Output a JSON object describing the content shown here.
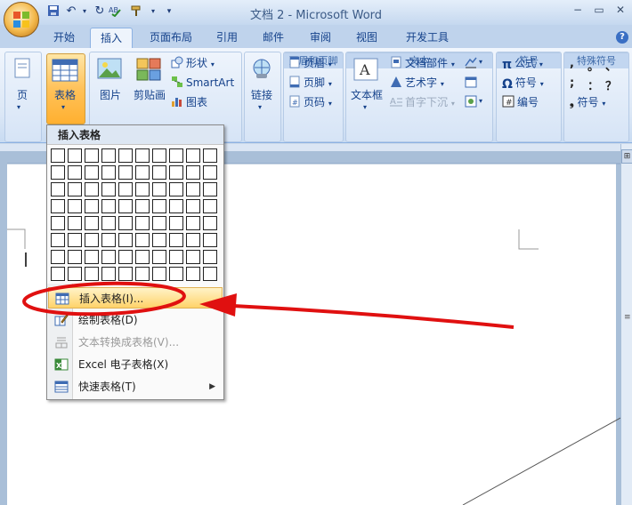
{
  "window": {
    "title": "文档 2 - Microsoft Word"
  },
  "quick_access": {
    "icons": [
      "save-icon",
      "undo-icon",
      "redo-icon",
      "spelling-icon",
      "format-painter-icon",
      "customize-icon"
    ]
  },
  "tabs": [
    "开始",
    "插入",
    "页面布局",
    "引用",
    "邮件",
    "审阅",
    "视图",
    "开发工具"
  ],
  "active_tab": "插入",
  "ribbon": {
    "pages": {
      "label": "页"
    },
    "table": {
      "label": "表格"
    },
    "illustrations": {
      "picture": "图片",
      "clipart": "剪贴画",
      "shapes": "形状",
      "smartart": "SmartArt",
      "chart": "图表"
    },
    "links": {
      "label": "链接"
    },
    "header_footer": {
      "header": "页眉",
      "footer": "页脚",
      "page_number": "页码",
      "group_label": "页眉和页脚"
    },
    "text": {
      "textbox": "文本框",
      "quickparts": "文档部件",
      "wordart": "艺术字",
      "dropcap": "首字下沉",
      "group_label": "文本"
    },
    "symbols": {
      "equation": "公式",
      "symbol": "符号",
      "numbering": "编号",
      "group_label": "符号"
    },
    "special": {
      "row1": [
        ",",
        "。",
        "、"
      ],
      "row2": [
        ";",
        "：",
        "？"
      ],
      "symbol_label": "符号",
      "group_label": "特殊符号"
    }
  },
  "dropdown": {
    "title": "插入表格",
    "grid": {
      "cols": 10,
      "rows": 8
    },
    "items": [
      {
        "label": "插入表格(I)...",
        "icon": "insert-table-icon",
        "enabled": true,
        "highlighted": true
      },
      {
        "label": "绘制表格(D)",
        "icon": "draw-table-icon",
        "enabled": true
      },
      {
        "label": "文本转换成表格(V)...",
        "icon": "convert-text-icon",
        "enabled": false
      },
      {
        "label": "Excel 电子表格(X)",
        "icon": "excel-icon",
        "enabled": true
      },
      {
        "label": "快速表格(T)",
        "icon": "quick-table-icon",
        "enabled": true,
        "submenu": true
      }
    ]
  },
  "annotation": {
    "color": "#e01010"
  }
}
